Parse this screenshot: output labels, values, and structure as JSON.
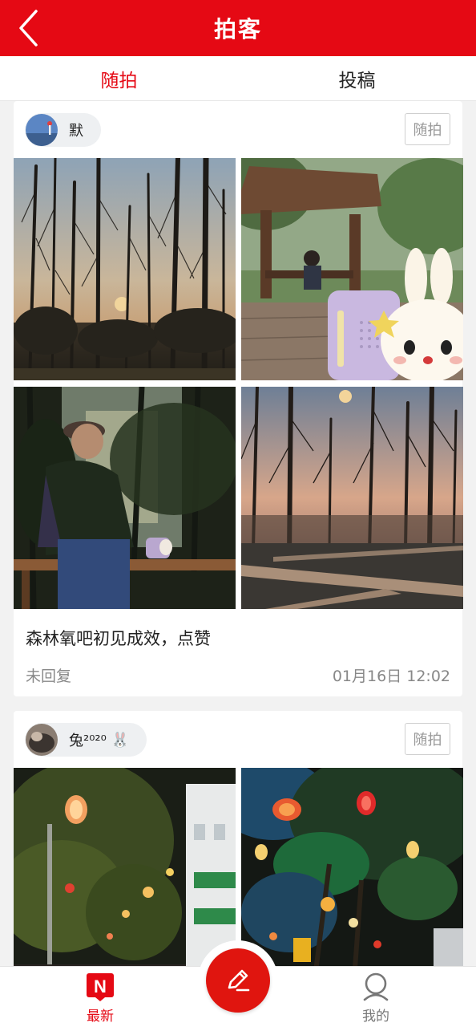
{
  "header": {
    "title": "拍客"
  },
  "tabs": [
    {
      "label": "随拍",
      "active": true
    },
    {
      "label": "投稿",
      "active": false
    }
  ],
  "posts": [
    {
      "user": "默",
      "tag": "随拍",
      "text": "森林氧吧初见成效，点赞",
      "status": "未回复",
      "time": "01月16日 12:02",
      "photos": [
        "forest-sunset-photo",
        "toy-rabbit-pavilion-photo",
        "person-on-bench-photo",
        "park-path-dusk-photo"
      ]
    },
    {
      "user": "兔²⁰²⁰",
      "user_emoji": "🐰",
      "tag": "随拍",
      "photos": [
        "lanterns-street-night-photo",
        "lanterns-trees-night-photo"
      ]
    }
  ],
  "bottom_nav": {
    "latest_label": "最新",
    "mine_label": "我的",
    "compose_icon": "pencil-icon"
  },
  "colors": {
    "accent": "#e50914",
    "muted": "#888888"
  }
}
